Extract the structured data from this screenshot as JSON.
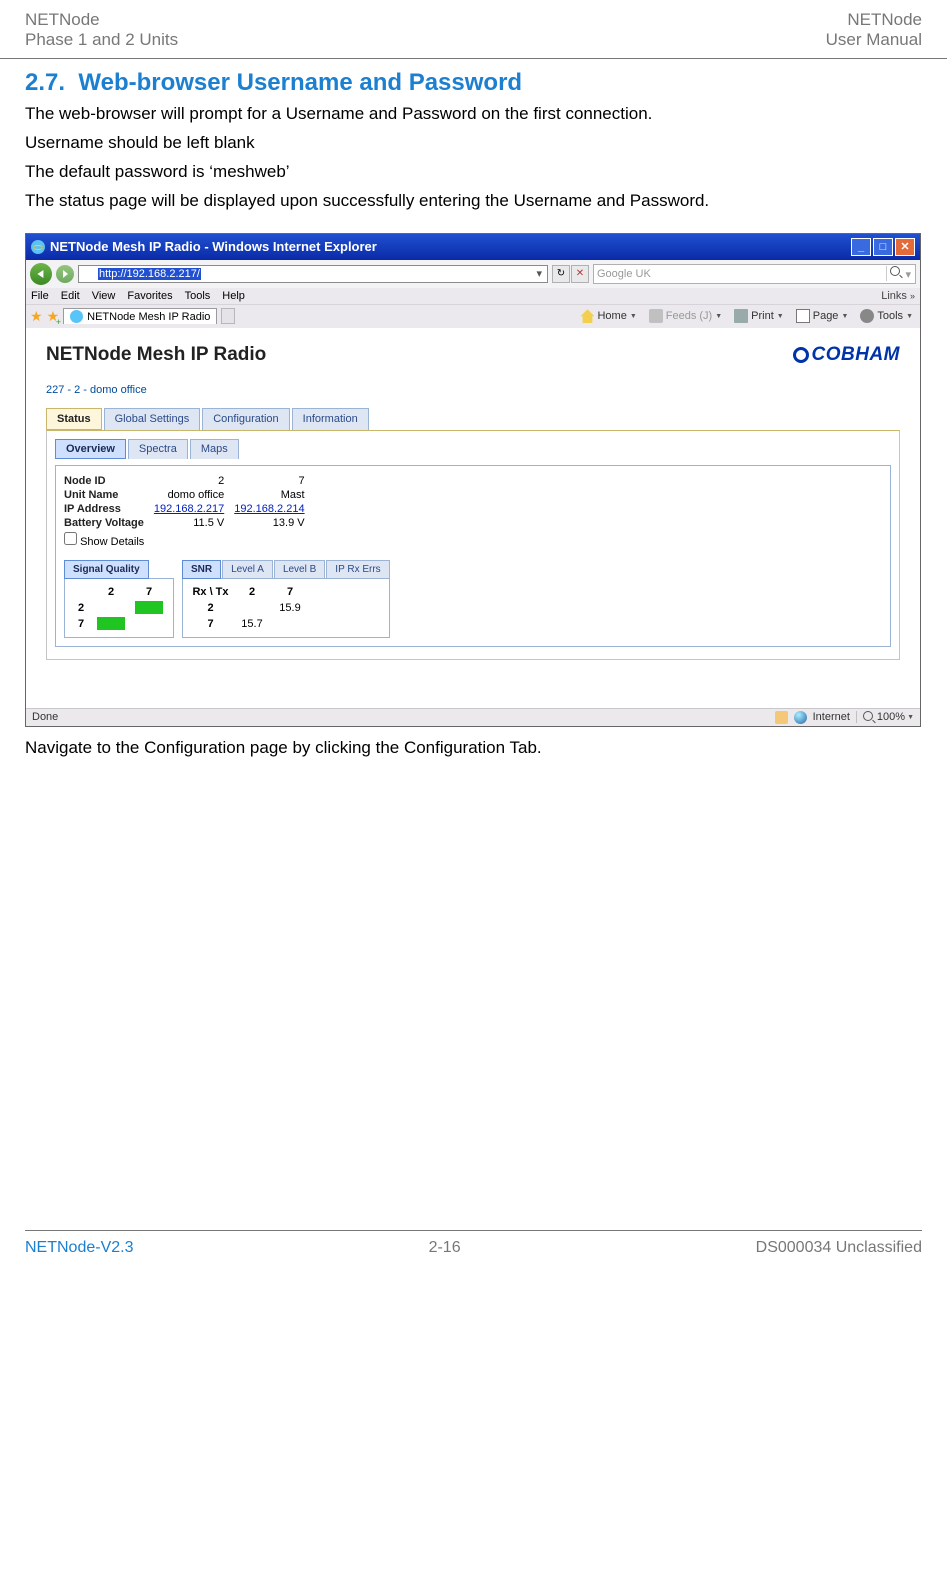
{
  "header": {
    "left_line1": "NETNode",
    "left_line2": "Phase 1 and 2 Units",
    "right_line1": "NETNode",
    "right_line2": "User Manual"
  },
  "section": {
    "number": "2.7.",
    "title": "Web-browser Username and Password"
  },
  "paragraphs": {
    "p1": "The web-browser will prompt for a Username and Password on the first connection.",
    "p2": "Username should be left blank",
    "p3": "The default password is ‘meshweb’",
    "p4": "The status page will be displayed upon successfully entering the Username and Password.",
    "p_after": "Navigate to the Configuration page by clicking the Configuration Tab."
  },
  "browser": {
    "title": "NETNode Mesh IP Radio - Windows Internet Explorer",
    "url": "http://192.168.2.217/",
    "search_placeholder": "Google UK",
    "menus": [
      "File",
      "Edit",
      "View",
      "Favorites",
      "Tools",
      "Help"
    ],
    "links_label": "Links",
    "tab_title": "NETNode Mesh IP Radio",
    "cmd": {
      "home": "Home",
      "feeds": "Feeds (J)",
      "print": "Print",
      "page": "Page",
      "tools": "Tools"
    },
    "status_done": "Done",
    "status_internet": "Internet",
    "zoom": "100%"
  },
  "webpage": {
    "title": "NETNode Mesh IP Radio",
    "brand": "COBHAM",
    "id_line": "227 - 2 - domo office",
    "main_tabs": [
      "Status",
      "Global Settings",
      "Configuration",
      "Information"
    ],
    "sub_tabs": [
      "Overview",
      "Spectra",
      "Maps"
    ],
    "overview": {
      "rows": [
        {
          "label": "Node ID",
          "a": "2",
          "b": "7"
        },
        {
          "label": "Unit Name",
          "a": "domo office",
          "b": "Mast"
        },
        {
          "label": "IP Address",
          "a": "192.168.2.217",
          "b": "192.168.2.214",
          "link": true
        },
        {
          "label": "Battery Voltage",
          "a": "11.5 V",
          "b": "13.9 V"
        }
      ],
      "show_details": "Show Details"
    },
    "signal": {
      "tab": "Signal Quality",
      "cols": [
        "2",
        "7"
      ],
      "rows": [
        "2",
        "7"
      ]
    },
    "snr": {
      "tabs": [
        "SNR",
        "Level A",
        "Level B",
        "IP Rx Errs"
      ],
      "head": "Rx \\ Tx",
      "cols": [
        "2",
        "7"
      ],
      "r1": {
        "lbl": "2",
        "a": "",
        "b": "15.9"
      },
      "r2": {
        "lbl": "7",
        "a": "15.7",
        "b": ""
      }
    }
  },
  "footer": {
    "left": "NETNode-V2.3",
    "center": "2-16",
    "right": "DS000034 Unclassified"
  }
}
